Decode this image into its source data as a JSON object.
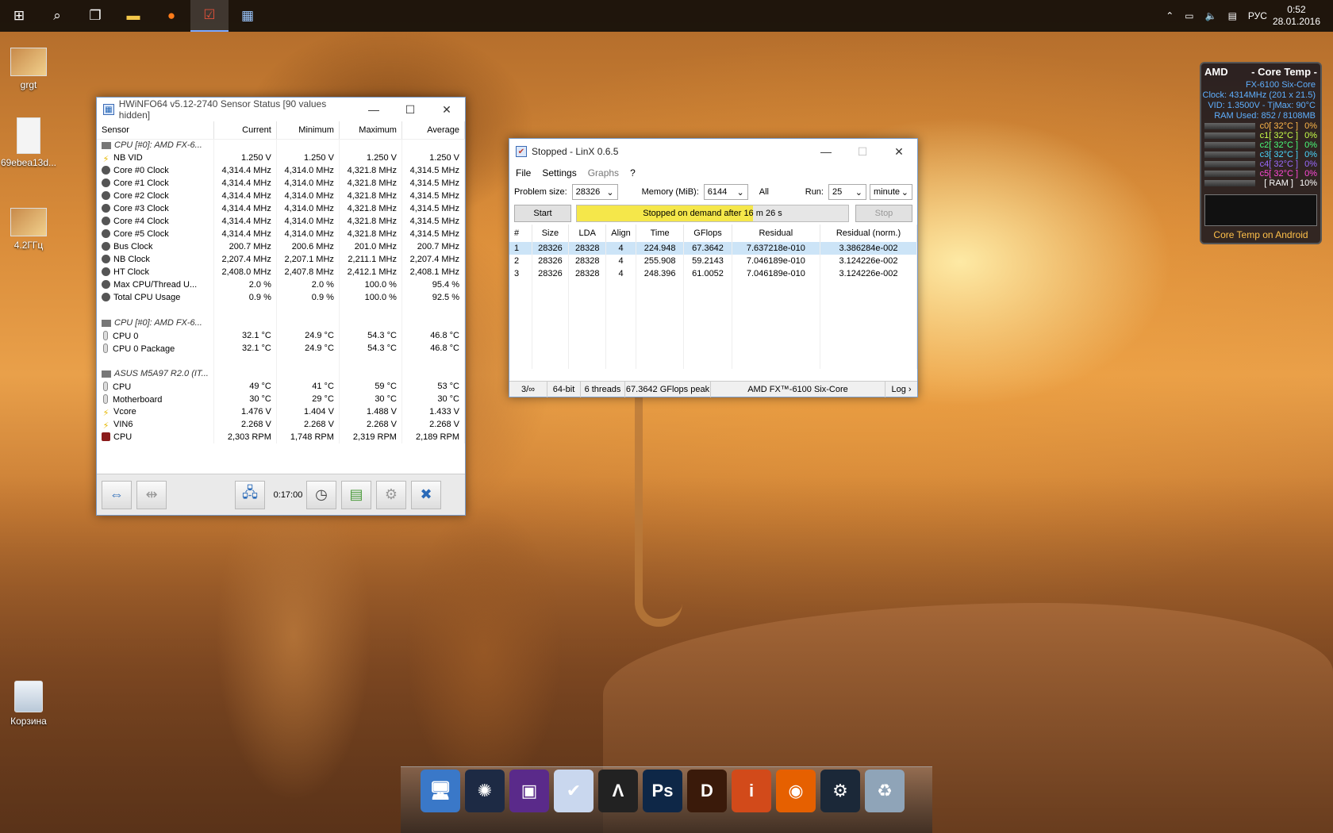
{
  "taskbar": {
    "icons": [
      "windows-start-icon",
      "search-icon",
      "task-view-icon",
      "file-explorer-icon",
      "firefox-icon",
      "linx-icon",
      "hwinfo-icon"
    ],
    "tray": {
      "language": "РУС",
      "time": "0:52",
      "date": "28.01.2016"
    }
  },
  "desktop_icons": [
    {
      "label": "grgt"
    },
    {
      "label": "69ebea13d..."
    },
    {
      "label": "4.2ГГц"
    },
    {
      "label": "Корзина"
    }
  ],
  "hwinfo": {
    "title": "HWiNFO64 v5.12-2740 Sensor Status [90 values hidden]",
    "columns": [
      "Sensor",
      "Current",
      "Minimum",
      "Maximum",
      "Average"
    ],
    "rows": [
      {
        "type": "group",
        "icon": "cpu-chip-icon",
        "cells": [
          "CPU [#0]: AMD FX-6...",
          "",
          "",
          "",
          ""
        ]
      },
      {
        "type": "v",
        "icon": "voltage-icon",
        "cells": [
          "NB VID",
          "1.250 V",
          "1.250 V",
          "1.250 V",
          "1.250 V"
        ]
      },
      {
        "type": "c",
        "icon": "clock-icon",
        "cells": [
          "Core #0 Clock",
          "4,314.4 MHz",
          "4,314.0 MHz",
          "4,321.8 MHz",
          "4,314.5 MHz"
        ]
      },
      {
        "type": "c",
        "icon": "clock-icon",
        "cells": [
          "Core #1 Clock",
          "4,314.4 MHz",
          "4,314.0 MHz",
          "4,321.8 MHz",
          "4,314.5 MHz"
        ]
      },
      {
        "type": "c",
        "icon": "clock-icon",
        "cells": [
          "Core #2 Clock",
          "4,314.4 MHz",
          "4,314.0 MHz",
          "4,321.8 MHz",
          "4,314.5 MHz"
        ]
      },
      {
        "type": "c",
        "icon": "clock-icon",
        "cells": [
          "Core #3 Clock",
          "4,314.4 MHz",
          "4,314.0 MHz",
          "4,321.8 MHz",
          "4,314.5 MHz"
        ]
      },
      {
        "type": "c",
        "icon": "clock-icon",
        "cells": [
          "Core #4 Clock",
          "4,314.4 MHz",
          "4,314.0 MHz",
          "4,321.8 MHz",
          "4,314.5 MHz"
        ]
      },
      {
        "type": "c",
        "icon": "clock-icon",
        "cells": [
          "Core #5 Clock",
          "4,314.4 MHz",
          "4,314.0 MHz",
          "4,321.8 MHz",
          "4,314.5 MHz"
        ]
      },
      {
        "type": "c",
        "icon": "clock-icon",
        "cells": [
          "Bus Clock",
          "200.7 MHz",
          "200.6 MHz",
          "201.0 MHz",
          "200.7 MHz"
        ]
      },
      {
        "type": "c",
        "icon": "clock-icon",
        "cells": [
          "NB Clock",
          "2,207.4 MHz",
          "2,207.1 MHz",
          "2,211.1 MHz",
          "2,207.4 MHz"
        ]
      },
      {
        "type": "c",
        "icon": "clock-icon",
        "cells": [
          "HT Clock",
          "2,408.0 MHz",
          "2,407.8 MHz",
          "2,412.1 MHz",
          "2,408.1 MHz"
        ]
      },
      {
        "type": "c",
        "icon": "usage-icon",
        "cells": [
          "Max CPU/Thread U...",
          "2.0 %",
          "2.0 %",
          "100.0 %",
          "95.4 %"
        ]
      },
      {
        "type": "c",
        "icon": "usage-icon",
        "cells": [
          "Total CPU Usage",
          "0.9 %",
          "0.9 %",
          "100.0 %",
          "92.5 %"
        ]
      },
      {
        "type": "blank",
        "icon": "",
        "cells": [
          "",
          "",
          "",
          "",
          ""
        ]
      },
      {
        "type": "group",
        "icon": "cpu-chip-icon",
        "cells": [
          "CPU [#0]: AMD FX-6...",
          "",
          "",
          "",
          ""
        ]
      },
      {
        "type": "t",
        "icon": "thermometer-icon",
        "cells": [
          "CPU 0",
          "32.1 °C",
          "24.9 °C",
          "54.3 °C",
          "46.8 °C"
        ]
      },
      {
        "type": "t",
        "icon": "thermometer-icon",
        "cells": [
          "CPU 0 Package",
          "32.1 °C",
          "24.9 °C",
          "54.3 °C",
          "46.8 °C"
        ]
      },
      {
        "type": "blank",
        "icon": "",
        "cells": [
          "",
          "",
          "",
          "",
          ""
        ]
      },
      {
        "type": "group",
        "icon": "motherboard-icon",
        "cells": [
          "ASUS M5A97 R2.0 (IT...",
          "",
          "",
          "",
          ""
        ]
      },
      {
        "type": "t",
        "icon": "thermometer-icon",
        "cells": [
          "CPU",
          "49 °C",
          "41 °C",
          "59 °C",
          "53 °C"
        ]
      },
      {
        "type": "t",
        "icon": "thermometer-icon",
        "cells": [
          "Motherboard",
          "30 °C",
          "29 °C",
          "30 °C",
          "30 °C"
        ]
      },
      {
        "type": "v",
        "icon": "voltage-icon",
        "cells": [
          "Vcore",
          "1.476 V",
          "1.404 V",
          "1.488 V",
          "1.433 V"
        ]
      },
      {
        "type": "v",
        "icon": "voltage-icon",
        "cells": [
          "VIN6",
          "2.268 V",
          "2.268 V",
          "2.268 V",
          "2.268 V"
        ]
      },
      {
        "type": "f",
        "icon": "fan-icon",
        "cells": [
          "CPU",
          "2,303 RPM",
          "1,748 RPM",
          "2,319 RPM",
          "2,189 RPM"
        ]
      }
    ],
    "footer": {
      "timer": "0:17:00"
    }
  },
  "linx": {
    "title": "Stopped - LinX 0.6.5",
    "menu": [
      "File",
      "Settings",
      "Graphs",
      "?"
    ],
    "problem_size_label": "Problem size:",
    "problem_size": "28326",
    "memory_label": "Memory (MiB):",
    "memory": "6144",
    "all_label": "All",
    "run_label": "Run:",
    "run_value": "25",
    "run_unit": "minute",
    "start_label": "Start",
    "progress_text": "Stopped on demand after 16 m 26 s",
    "progress_fraction": 0.65,
    "stop_label": "Stop",
    "columns": [
      "#",
      "Size",
      "LDA",
      "Align",
      "Time",
      "GFlops",
      "Residual",
      "Residual (norm.)"
    ],
    "rows": [
      [
        "1",
        "28326",
        "28328",
        "4",
        "224.948",
        "67.3642",
        "7.637218e-010",
        "3.386284e-002"
      ],
      [
        "2",
        "28326",
        "28328",
        "4",
        "255.908",
        "59.2143",
        "7.046189e-010",
        "3.124226e-002"
      ],
      [
        "3",
        "28326",
        "28328",
        "4",
        "248.396",
        "61.0052",
        "7.046189e-010",
        "3.124226e-002"
      ]
    ],
    "status": [
      "3/∞",
      "64-bit",
      "6 threads",
      "67.3642 GFlops peak",
      "AMD FX™-6100 Six-Core",
      "Log ›"
    ]
  },
  "coretemp": {
    "brand": "AMD",
    "title": "- Core Temp -",
    "cpu": "FX-6100 Six-Core",
    "clock": "Clock: 4314MHz (201 x 21.5)",
    "vid": "VID: 1.3500V - TjMax: 90°C",
    "ram": "RAM Used: 852 / 8108MB",
    "cores": [
      {
        "label": "c0[ 32°C ]",
        "load": "0%",
        "color": "#ffb84a"
      },
      {
        "label": "c1[ 32°C ]",
        "load": "0%",
        "color": "#c8ff4a"
      },
      {
        "label": "c2[ 32°C ]",
        "load": "0%",
        "color": "#4aff7a"
      },
      {
        "label": "c3[ 32°C ]",
        "load": "0%",
        "color": "#4ad8ff"
      },
      {
        "label": "c4[ 32°C ]",
        "load": "0%",
        "color": "#9a6bff"
      },
      {
        "label": "c5[ 32°C ]",
        "load": "0%",
        "color": "#ff4ad8"
      }
    ],
    "ram_label": "[ RAM ]",
    "ram_load": "10%",
    "footer": "Core Temp on Android"
  },
  "dock": {
    "icons": [
      {
        "name": "computer-icon",
        "glyph": "🖥",
        "bg": "#3a78c8"
      },
      {
        "name": "battlenet-icon",
        "glyph": "✺",
        "bg": "#1d2a44"
      },
      {
        "name": "cpuz-icon",
        "glyph": "▣",
        "bg": "#5a2a8a"
      },
      {
        "name": "linx-dock-icon",
        "glyph": "✔",
        "bg": "#c9d7ee"
      },
      {
        "name": "assassins-creed-icon",
        "glyph": "Λ",
        "bg": "#222"
      },
      {
        "name": "photoshop-icon",
        "glyph": "Ps",
        "bg": "#0e2747"
      },
      {
        "name": "diablo-icon",
        "glyph": "D",
        "bg": "#3a1a0a"
      },
      {
        "name": "info-icon",
        "glyph": "i",
        "bg": "#d24a1a"
      },
      {
        "name": "firefox-dock-icon",
        "glyph": "◉",
        "bg": "#e66000"
      },
      {
        "name": "steam-icon",
        "glyph": "⚙",
        "bg": "#1b2838"
      },
      {
        "name": "recycle-bin-dock-icon",
        "glyph": "♻",
        "bg": "#8fa4b8"
      }
    ]
  }
}
